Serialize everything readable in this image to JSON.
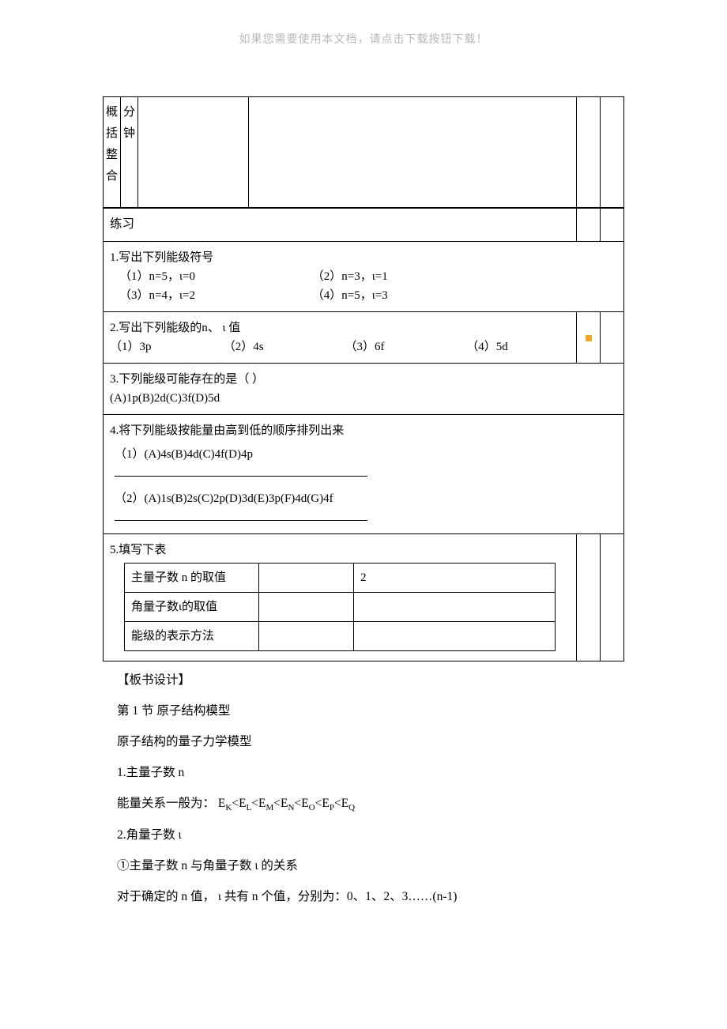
{
  "header_note": "如果您需要使用本文档，请点击下载按钮下载！",
  "top_row": {
    "col1_chars": [
      "概",
      "括",
      "整",
      "合"
    ],
    "col2_chars": [
      "分",
      "钟"
    ]
  },
  "exercise_title": "练习",
  "q1": {
    "title": "1.写出下列能级符号",
    "items": [
      "（1）n=5，ι=0",
      "（2）n=3，ι=1",
      "（3）n=4，ι=2",
      "（4）n=5，ι=3"
    ]
  },
  "q2": {
    "title": "2.写出下列能级的n、 ι 值",
    "items": [
      "（1）3p",
      "（2）4s",
      "（3）6f",
      "（4）5d"
    ]
  },
  "q3": {
    "title": "3.下列能级可能存在的是（        ）",
    "options": "(A)1p(B)2d(C)3f(D)5d"
  },
  "q4": {
    "title": "4.将下列能级按能量由高到低的顺序排列出来",
    "item1_prefix": "（1）(A)4s(B)4d(C)4f(D)4p",
    "item2_prefix": "（2）(A)1s(B)2s(C)2p(D)3d(E)3p(F)4d(G)4f"
  },
  "q5": {
    "title": "5.填写下表",
    "table": {
      "row1_label": "主量子数 n 的取值",
      "row1_val": "2",
      "row2_label": "角量子数ι的取值",
      "row3_label": "能级的表示方法"
    }
  },
  "board": {
    "heading": "【板书设计】",
    "line1": "第 1 节  原子结构模型",
    "line2": "原子结构的量子力学模型",
    "line3": "1.主量子数 n",
    "line4_prefix": "能量关系一般为：",
    "line4_rel": [
      "K",
      "L",
      "M",
      "N",
      "O",
      "P",
      "Q"
    ],
    "line5": "2.角量子数  ι",
    "line6": "①主量子数 n 与角量子数  ι 的关系",
    "line7": "对于确定的 n 值， ι 共有 n 个值，分别为：0、1、2、3……(n-1)"
  }
}
